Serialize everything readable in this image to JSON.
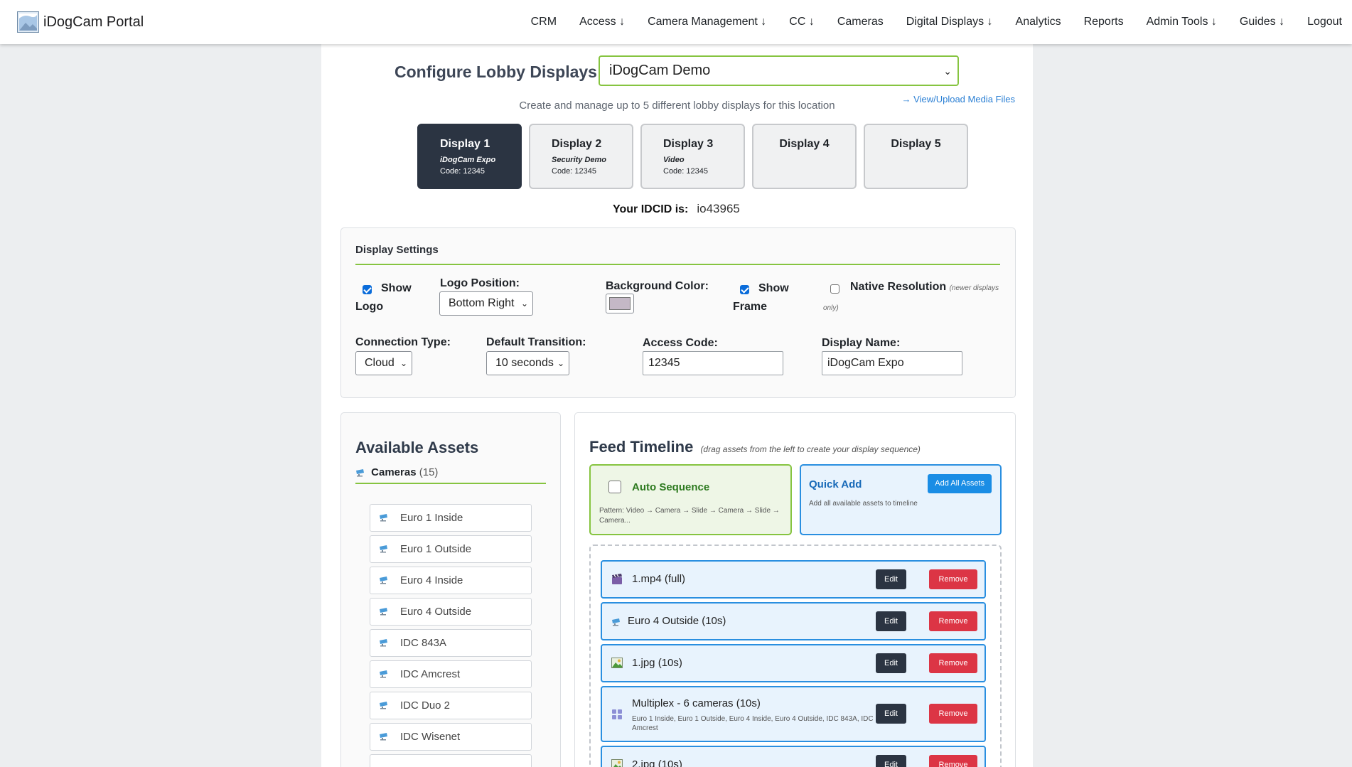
{
  "nav": {
    "brand": "iDogCam Portal",
    "items": [
      "CRM",
      "Access ↓",
      "Camera Management ↓",
      "CC ↓",
      "Cameras",
      "Digital Displays ↓",
      "Analytics",
      "Reports",
      "Admin Tools ↓",
      "Guides ↓",
      "Logout"
    ]
  },
  "header": {
    "title": "Configure Lobby Displays -",
    "location": "iDogCam Demo",
    "subtitle": "Create and manage up to 5 different lobby displays for this location",
    "media_link": "→ View/Upload Media Files"
  },
  "tabs": [
    {
      "label": "Display 1",
      "name": "iDogCam Expo",
      "code": "Code: 12345",
      "active": true
    },
    {
      "label": "Display 2",
      "name": "Security Demo",
      "code": "Code: 12345",
      "active": false
    },
    {
      "label": "Display 3",
      "name": "Video",
      "code": "Code: 12345",
      "active": false
    },
    {
      "label": "Display 4",
      "name": "",
      "code": "",
      "active": false
    },
    {
      "label": "Display 5",
      "name": "",
      "code": "",
      "active": false
    }
  ],
  "idcid": {
    "label": "Your IDCID is:",
    "value": "io43965"
  },
  "settings": {
    "title": "Display Settings",
    "show_logo": {
      "line1": "Show",
      "line2": "Logo",
      "checked": true
    },
    "logo_position": {
      "label": "Logo Position:",
      "value": "Bottom Right"
    },
    "background_color": {
      "label": "Background Color:",
      "value": "#c4b8c6"
    },
    "show_frame": {
      "line1": "Show",
      "line2": "Frame",
      "checked": true
    },
    "native_resolution": {
      "label": "Native Resolution",
      "note1": "(newer displays",
      "note2": "only)",
      "checked": false
    },
    "connection_type": {
      "label": "Connection Type:",
      "value": "Cloud"
    },
    "default_transition": {
      "label": "Default Transition:",
      "value": "10 seconds"
    },
    "access_code": {
      "label": "Access Code:",
      "value": "12345"
    },
    "display_name": {
      "label": "Display Name:",
      "value": "iDogCam Expo"
    }
  },
  "assets": {
    "title": "Available Assets",
    "category": "Cameras",
    "count": "(15)",
    "items": [
      "Euro 1 Inside",
      "Euro 1 Outside",
      "Euro 4 Inside",
      "Euro 4 Outside",
      "IDC 843A",
      "IDC Amcrest",
      "IDC Duo 2",
      "IDC Wisenet"
    ]
  },
  "timeline": {
    "title": "Feed Timeline",
    "hint": "(drag assets from the left to create your display sequence)",
    "auto": {
      "title": "Auto Sequence",
      "pattern": "Pattern: Video → Camera → Slide → Camera → Slide → Camera...",
      "checked": false
    },
    "quick": {
      "title": "Quick Add",
      "button": "Add All Assets",
      "desc": "Add all available assets to timeline"
    },
    "edit_label": "Edit",
    "remove_label": "Remove",
    "items": [
      {
        "icon": "clapper-icon",
        "name": "1.mp4 (full)",
        "detail": ""
      },
      {
        "icon": "camera-icon",
        "name": "Euro 4 Outside (10s)",
        "detail": ""
      },
      {
        "icon": "image-icon",
        "name": "1.jpg (10s)",
        "detail": ""
      },
      {
        "icon": "grid-icon",
        "name": "Multiplex - 6 cameras (10s)",
        "detail": "Euro 1 Inside, Euro 1 Outside, Euro 4 Inside, Euro 4 Outside, IDC 843A, IDC Amcrest"
      },
      {
        "icon": "image-icon",
        "name": "2.jpg (10s)",
        "detail": ""
      }
    ]
  },
  "colors": {
    "accent_green": "#86c440",
    "accent_blue": "#2a8fe0",
    "dark": "#2b3442",
    "danger": "#dc3545"
  }
}
